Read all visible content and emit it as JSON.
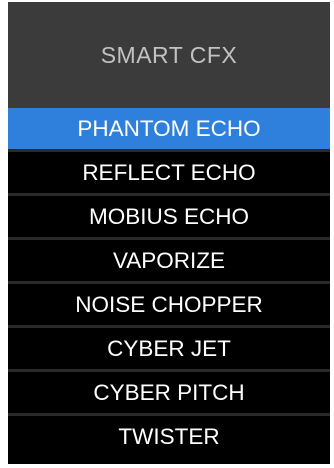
{
  "header": {
    "title": "SMART CFX"
  },
  "menu": {
    "selected_index": 0,
    "colors": {
      "selected": "#2f80dc",
      "background": "#000000",
      "header": "#3b3b3b"
    },
    "items": [
      {
        "label": "PHANTOM ECHO"
      },
      {
        "label": "REFLECT ECHO"
      },
      {
        "label": "MOBIUS ECHO"
      },
      {
        "label": "VAPORIZE"
      },
      {
        "label": "NOISE CHOPPER"
      },
      {
        "label": "CYBER JET"
      },
      {
        "label": "CYBER PITCH"
      },
      {
        "label": "TWISTER"
      }
    ]
  }
}
